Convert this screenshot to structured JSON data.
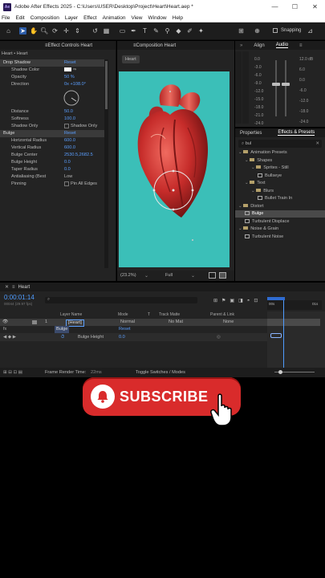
{
  "window": {
    "title": "Adobe After Effects 2025 - C:\\Users\\USER\\Desktop\\Project\\Heart\\Heart.aep *",
    "logo": "Ae"
  },
  "menu": [
    "File",
    "Edit",
    "Composition",
    "Layer",
    "Effect",
    "Animation",
    "View",
    "Window",
    "Help"
  ],
  "toolbar": {
    "snapping_label": "Snapping"
  },
  "effect_controls": {
    "tab": "Effect Controls Heart",
    "layer": "Heart • Heart",
    "props": [
      {
        "name": "Drop Shadow",
        "value": "Reset",
        "type": "fx"
      },
      {
        "name": "Shadow Color",
        "value": "",
        "type": "color"
      },
      {
        "name": "Opacity",
        "value": "50 %",
        "type": "num"
      },
      {
        "name": "Direction",
        "value": "0x +108.0°",
        "type": "num"
      },
      {
        "name": "Distance",
        "value": "50.0",
        "type": "num"
      },
      {
        "name": "Softness",
        "value": "100.0",
        "type": "num"
      },
      {
        "name": "Shadow Only",
        "value": "Shadow Only",
        "type": "check"
      },
      {
        "name": "Bulge",
        "value": "Reset",
        "type": "fx"
      },
      {
        "name": "Horizontal Radius",
        "value": "600.0",
        "type": "num"
      },
      {
        "name": "Vertical Radius",
        "value": "600.0",
        "type": "num"
      },
      {
        "name": "Bulge Center",
        "value": "2530.5,2682.5",
        "type": "num"
      },
      {
        "name": "Bulge Height",
        "value": "0.0",
        "type": "num"
      },
      {
        "name": "Taper Radius",
        "value": "0.0",
        "type": "num"
      },
      {
        "name": "Antialiasing (Best",
        "value": "Low",
        "type": "select"
      },
      {
        "name": "Pinning",
        "value": "Pin All Edges",
        "type": "check"
      }
    ]
  },
  "composition": {
    "tab": "Composition Heart",
    "sub_tab": "Heart",
    "zoom": "(23.2%)",
    "resolution": "Full",
    "bg_color": "#3bbfb8"
  },
  "right_panel": {
    "tabs_top": [
      "Align",
      "Audio"
    ],
    "audio_left_scale": [
      "0.0",
      "-3.0",
      "-6.0",
      "-9.0",
      "-12.0",
      "-15.0",
      "-18.0",
      "-21.0",
      "-24.0"
    ],
    "audio_right_scale": [
      "12.0 dB",
      "6.0",
      "0.0",
      "-6.0",
      "-12.0",
      "-18.0",
      "-24.0"
    ],
    "tabs_mid": [
      "Properties",
      "Effects & Presets"
    ],
    "search": "bul",
    "tree": [
      {
        "label": "Animation Presets",
        "indent": 0,
        "kind": "folder"
      },
      {
        "label": "Shapes",
        "indent": 1,
        "kind": "folder"
      },
      {
        "label": "Sprites - Still",
        "indent": 2,
        "kind": "folder"
      },
      {
        "label": "Bullseye",
        "indent": 3,
        "kind": "preset"
      },
      {
        "label": "Text",
        "indent": 1,
        "kind": "folder"
      },
      {
        "label": "Blurs",
        "indent": 2,
        "kind": "folder"
      },
      {
        "label": "Bullet Train In",
        "indent": 3,
        "kind": "preset"
      },
      {
        "label": "Distort",
        "indent": 0,
        "kind": "folder"
      },
      {
        "label": "Bulge",
        "indent": 1,
        "kind": "effect",
        "selected": true
      },
      {
        "label": "Turbulent Displace",
        "indent": 1,
        "kind": "effect"
      },
      {
        "label": "Noise & Grain",
        "indent": 0,
        "kind": "folder"
      },
      {
        "label": "Turbulent Noise",
        "indent": 1,
        "kind": "effect"
      }
    ]
  },
  "timeline": {
    "tab": "Heart",
    "timecode": "0:00:01:14",
    "frames": "00044 (29.97 fps)",
    "search_placeholder": "",
    "columns": [
      "Layer Name",
      "Mode",
      "T",
      "Track Matte",
      "Parent & Link"
    ],
    "layer": {
      "num": "1",
      "name": "[Heart]",
      "mode": "Normal",
      "matte": "No Mat",
      "parent": "None"
    },
    "effect_row": {
      "name": "Bulge",
      "value": "Reset"
    },
    "prop_row": {
      "name": "Bulge Height",
      "value": "0.0"
    },
    "ruler": [
      "00s",
      "01s"
    ],
    "footer_left": "Frame Render Time:",
    "footer_time": "22ms",
    "footer_mid": "Toggle Switches / Modes"
  },
  "subscribe": {
    "label": "SUBSCRIBE",
    "color": "#d92b2b"
  }
}
